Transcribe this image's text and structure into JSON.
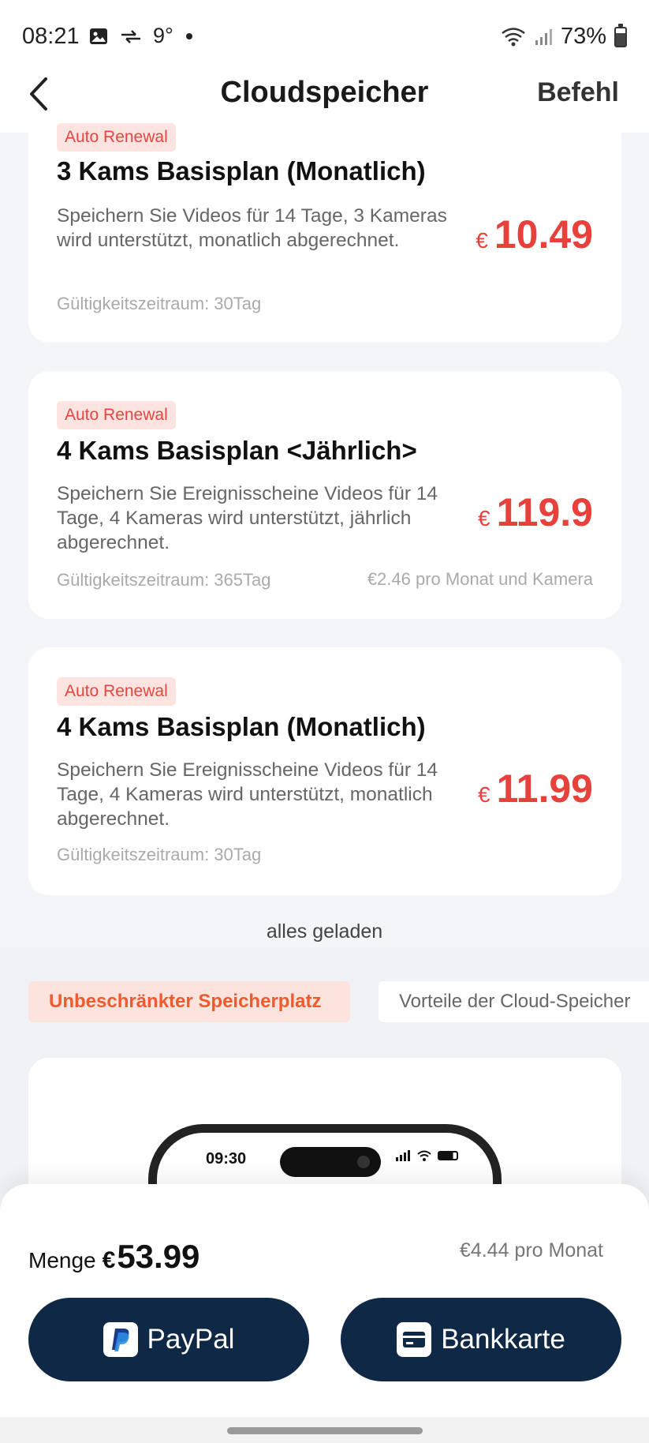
{
  "status_bar": {
    "time": "08:21",
    "temperature": "9°",
    "battery": "73%",
    "icons": [
      "image-icon",
      "data-transfer-icon",
      "dot-icon",
      "wifi-icon",
      "signal-icon",
      "battery-icon"
    ]
  },
  "header": {
    "title": "Cloudspeicher",
    "action": "Befehl"
  },
  "plans": [
    {
      "badge": "Auto Renewal",
      "name": "3 Kams Basisplan (Monatlich)",
      "description": "Speichern Sie Videos für 14 Tage, 3 Kameras wird unterstützt, monatlich abgerechnet.",
      "validity": "Gültigkeitszeitraum: 30Tag",
      "extra": "",
      "currency": "€",
      "price": "10.49"
    },
    {
      "badge": "Auto Renewal",
      "name": "4 Kams Basisplan <Jährlich>",
      "description": "Speichern Sie Ereignisscheine Videos für 14 Tage, 4 Kameras wird unterstützt, jährlich abgerechnet.",
      "validity": "Gültigkeitszeitraum: 365Tag",
      "extra": "€2.46 pro Monat und Kamera",
      "currency": "€",
      "price": "119.9"
    },
    {
      "badge": "Auto Renewal",
      "name": "4 Kams Basisplan (Monatlich)",
      "description": "Speichern Sie Ereignisscheine Videos für 14 Tage, 4 Kameras wird unterstützt, monatlich abgerechnet.",
      "validity": "Gültigkeitszeitraum: 30Tag",
      "extra": "",
      "currency": "€",
      "price": "11.99"
    }
  ],
  "loaded_text": "alles geladen",
  "tabs": [
    {
      "label": "Unbeschränkter Speicherplatz",
      "active": true
    },
    {
      "label": "Vorteile der Cloud-Speicher",
      "active": false
    }
  ],
  "preview": {
    "phone_time": "09:30"
  },
  "checkout": {
    "total_label": "Menge",
    "currency": "€",
    "total": "53.99",
    "per_month": "€4.44 pro Monat",
    "paypal_label": "PayPal",
    "card_label": "Bankkarte"
  },
  "colors": {
    "accent": "#e8403b",
    "button": "#0f2845",
    "tab_active": "#ef5a2f"
  }
}
